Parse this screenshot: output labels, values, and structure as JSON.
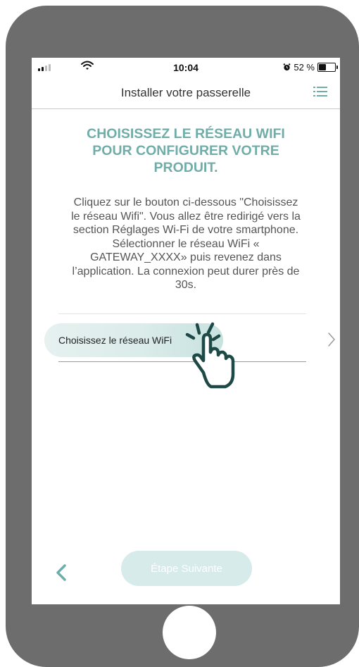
{
  "status_bar": {
    "time": "10:04",
    "battery": "52 %",
    "battery_level": 0.52
  },
  "nav": {
    "title": "Installer votre passerelle"
  },
  "content": {
    "heading_lines": [
      "CHOISISSEZ LE RÉSEAU WIFI",
      "POUR CONFIGURER VOTRE",
      "PRODUIT."
    ],
    "description_lines": [
      "Cliquez sur le bouton ci-dessous \"Choisissez",
      "le réseau Wifi\". Vous allez être redirigé vers la",
      "section Réglages Wi-Fi de votre smartphone.",
      "Sélectionner le réseau WiFi «",
      "GATEWAY_XXXX» puis revenez dans",
      "l’application. La connexion peut durer près de",
      "30s."
    ],
    "wifi_button_label": "Choisissez le réseau WiFi"
  },
  "footer": {
    "next_label": "Étape Suivante"
  },
  "colors": {
    "accent": "#6fada9",
    "button_tint": "#d6ebea",
    "frame": "#6d6d6d"
  }
}
